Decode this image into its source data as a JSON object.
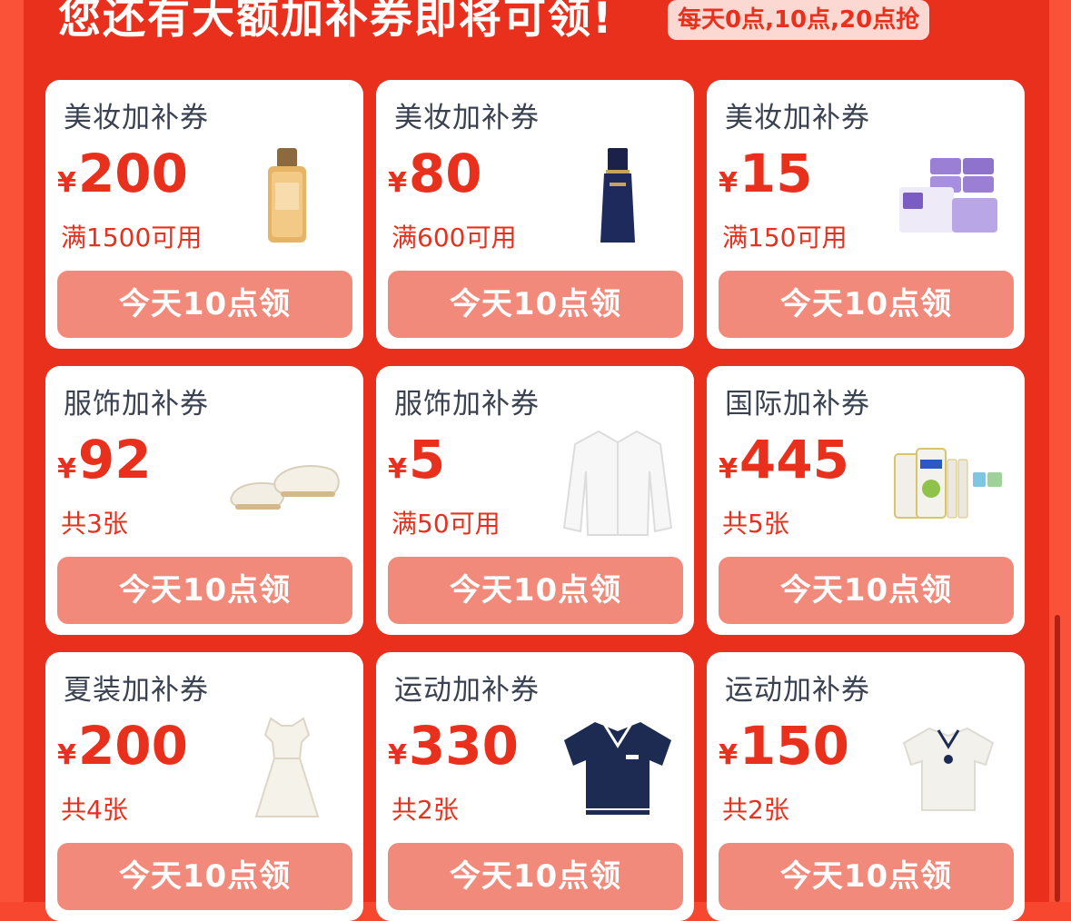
{
  "header": {
    "title": "您还有大额加补券即将可领!",
    "badge": "每天0点,10点,20点抢"
  },
  "currency_symbol": "¥",
  "colors": {
    "background": "#e8301d",
    "accent": "#e8301d",
    "button": "#f18a7b",
    "card": "#ffffff"
  },
  "coupons": [
    {
      "category": "美妆加补券",
      "amount": "200",
      "condition": "满1500可用",
      "button_label": "今天10点领",
      "image": "serum-bottle-icon"
    },
    {
      "category": "美妆加补券",
      "amount": "80",
      "condition": "满600可用",
      "button_label": "今天10点领",
      "image": "cosmetic-tube-icon"
    },
    {
      "category": "美妆加补券",
      "amount": "15",
      "condition": "满150可用",
      "button_label": "今天10点领",
      "image": "tissue-packs-icon"
    },
    {
      "category": "服饰加补券",
      "amount": "92",
      "condition": "共3张",
      "button_label": "今天10点领",
      "image": "white-shoes-icon"
    },
    {
      "category": "服饰加补券",
      "amount": "5",
      "condition": "满50可用",
      "button_label": "今天10点领",
      "image": "white-cardigan-icon"
    },
    {
      "category": "国际加补券",
      "amount": "445",
      "condition": "共5张",
      "button_label": "今天10点领",
      "image": "formula-cans-icon"
    },
    {
      "category": "夏装加补券",
      "amount": "200",
      "condition": "共4张",
      "button_label": "今天10点领",
      "image": "white-dress-icon"
    },
    {
      "category": "运动加补券",
      "amount": "330",
      "condition": "共2张",
      "button_label": "今天10点领",
      "image": "navy-polo-icon"
    },
    {
      "category": "运动加补券",
      "amount": "150",
      "condition": "共2张",
      "button_label": "今天10点领",
      "image": "white-polo-icon"
    }
  ]
}
